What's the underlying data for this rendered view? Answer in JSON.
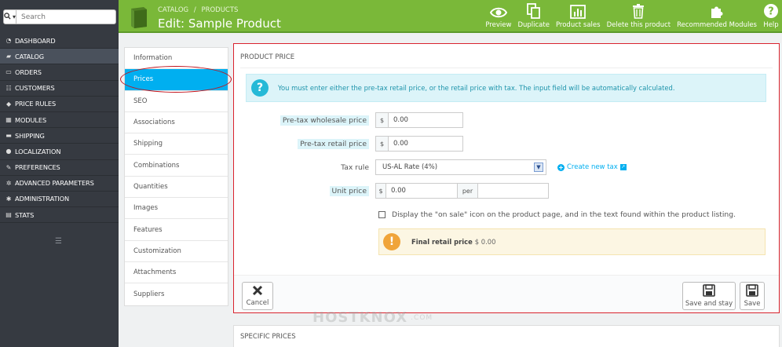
{
  "sidebar": {
    "search_placeholder": "Search",
    "items": [
      {
        "label": "DASHBOARD",
        "icon": "dashboard-icon"
      },
      {
        "label": "CATALOG",
        "icon": "book-icon",
        "active": true
      },
      {
        "label": "ORDERS",
        "icon": "credit-card-icon"
      },
      {
        "label": "CUSTOMERS",
        "icon": "users-icon"
      },
      {
        "label": "PRICE RULES",
        "icon": "tag-icon"
      },
      {
        "label": "MODULES",
        "icon": "puzzle-icon"
      },
      {
        "label": "SHIPPING",
        "icon": "truck-icon"
      },
      {
        "label": "LOCALIZATION",
        "icon": "globe-icon"
      },
      {
        "label": "PREFERENCES",
        "icon": "wrench-icon"
      },
      {
        "label": "ADVANCED PARAMETERS",
        "icon": "cogs-icon"
      },
      {
        "label": "ADMINISTRATION",
        "icon": "gear-icon"
      },
      {
        "label": "STATS",
        "icon": "bar-chart-icon"
      }
    ]
  },
  "header": {
    "breadcrumb": [
      "CATALOG",
      "/",
      "PRODUCTS"
    ],
    "title": "Edit: Sample Product",
    "color": "#7ab839",
    "toolbar": [
      {
        "label": "Preview",
        "icon": "eye-icon"
      },
      {
        "label": "Duplicate",
        "icon": "copy-icon"
      },
      {
        "label": "Product sales",
        "icon": "bar-chart-icon"
      },
      {
        "label": "Delete this product",
        "icon": "trash-icon"
      },
      {
        "label": "Recommended Modules",
        "icon": "puzzle-icon"
      },
      {
        "label": "Help",
        "icon": "help-icon"
      }
    ]
  },
  "tabs": [
    "Information",
    "Prices",
    "SEO",
    "Associations",
    "Shipping",
    "Combinations",
    "Quantities",
    "Images",
    "Features",
    "Customization",
    "Attachments",
    "Suppliers"
  ],
  "active_tab": "Prices",
  "panel": {
    "title": "PRODUCT PRICE",
    "info": "You must enter either the pre-tax retail price, or the retail price with tax. The input field will be automatically calculated.",
    "wholesale_label": "Pre-tax wholesale price",
    "wholesale_currency": "$",
    "wholesale_value": "0.00",
    "retail_label": "Pre-tax retail price",
    "retail_currency": "$",
    "retail_value": "0.00",
    "tax_label": "Tax rule",
    "tax_value": "US-AL Rate (4%)",
    "new_tax_link": "Create new tax",
    "unit_label": "Unit price",
    "unit_currency": "$",
    "unit_value": "0.00",
    "unit_per": "per",
    "unit_per_value": "",
    "on_sale_label": "Display the \"on sale\" icon on the product page, and in the text found within the product listing.",
    "final_label": "Final retail price",
    "final_value": "$ 0.00",
    "cancel_label": "Cancel",
    "save_stay_label": "Save and stay",
    "save_label": "Save"
  },
  "specific": {
    "title": "SPECIFIC PRICES"
  },
  "watermark": {
    "text": "HOSTKNOX",
    "suffix": ".COM"
  }
}
